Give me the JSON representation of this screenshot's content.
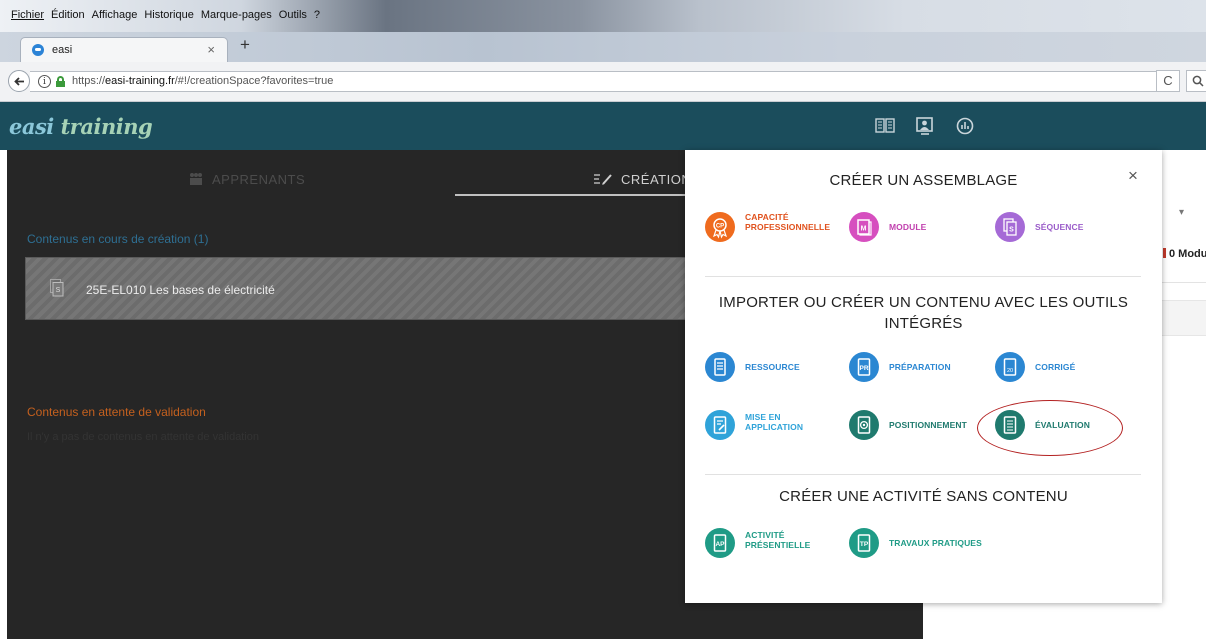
{
  "menubar": {
    "items": [
      "Fichier",
      "Édition",
      "Affichage",
      "Historique",
      "Marque-pages",
      "Outils",
      "?"
    ]
  },
  "browser": {
    "tab_title": "easi",
    "tab_close": "×",
    "new_tab": "+",
    "url_prefix": "https://",
    "url_domain": "easi-training.fr",
    "url_path": "/#!/creationSpace?favorites=true",
    "reload_glyph": "C"
  },
  "app": {
    "logo_part1": "easi",
    "logo_part2": "training",
    "header_icons": [
      "book-icon",
      "presenter-icon",
      "stats-icon"
    ]
  },
  "tabs": {
    "apprenants": "APPRENANTS",
    "creation": "CRÉATION"
  },
  "main": {
    "section_in_progress": "Contenus en cours de création (1)",
    "content_item": "25E-EL010 Les bases de électricité",
    "section_pending": "Contenus en attente de validation",
    "section_pending_empty": "Il n'y a pas de contenus en attente de validation"
  },
  "right_panel": {
    "dropdown_glyph": "▾",
    "count_label": "0 Modu"
  },
  "modal": {
    "close": "×",
    "section1_title": "CRÉER UN ASSEMBLAGE",
    "section2_title_line1": "IMPORTER OU CRÉER UN CONTENU AVEC LES OUTILS",
    "section2_title_line2": "INTÉGRÉS",
    "section3_title": "CRÉER UNE ACTIVITÉ SANS CONTENU",
    "assemblage": [
      {
        "line1": "CAPACITÉ",
        "line2": "PROFESSIONNELLE",
        "glyph": "CP",
        "color": "#ef6b1e"
      },
      {
        "line1": "MODULE",
        "line2": "",
        "glyph": "M",
        "color": "#d64fbf"
      },
      {
        "line1": "SÉQUENCE",
        "line2": "",
        "glyph": "S",
        "color": "#a56ad6"
      }
    ],
    "contenu": [
      {
        "line1": "RESSOURCE",
        "line2": "",
        "glyph": "",
        "color": "#2b87d2"
      },
      {
        "line1": "PRÉPARATION",
        "line2": "",
        "glyph": "PR",
        "color": "#2b87d2"
      },
      {
        "line1": "CORRIGÉ",
        "line2": "",
        "glyph": "20",
        "color": "#2b87d2"
      },
      {
        "line1": "MISE EN",
        "line2": "APPLICATION",
        "glyph": "",
        "color": "#2fa3d9"
      },
      {
        "line1": "POSITIONNEMENT",
        "line2": "",
        "glyph": "◎",
        "color": "#1f7a6e"
      },
      {
        "line1": "ÉVALUATION",
        "line2": "",
        "glyph": "",
        "color": "#1f7a6e"
      }
    ],
    "activite": [
      {
        "line1": "ACTIVITÉ",
        "line2": "PRÉSENTIELLE",
        "glyph": "AP",
        "color": "#1f9b86"
      },
      {
        "line1": "TRAVAUX PRATIQUES",
        "line2": "",
        "glyph": "TP",
        "color": "#1f9b86"
      }
    ],
    "label_colors": {
      "assemblage_cp": "#e0521e",
      "assemblage_module": "#c13fae",
      "assemblage_sequence": "#9a5cc9",
      "contenu": "#2b87d2",
      "positionnement": "#1f7a6e",
      "activite": "#1f9b86"
    }
  }
}
